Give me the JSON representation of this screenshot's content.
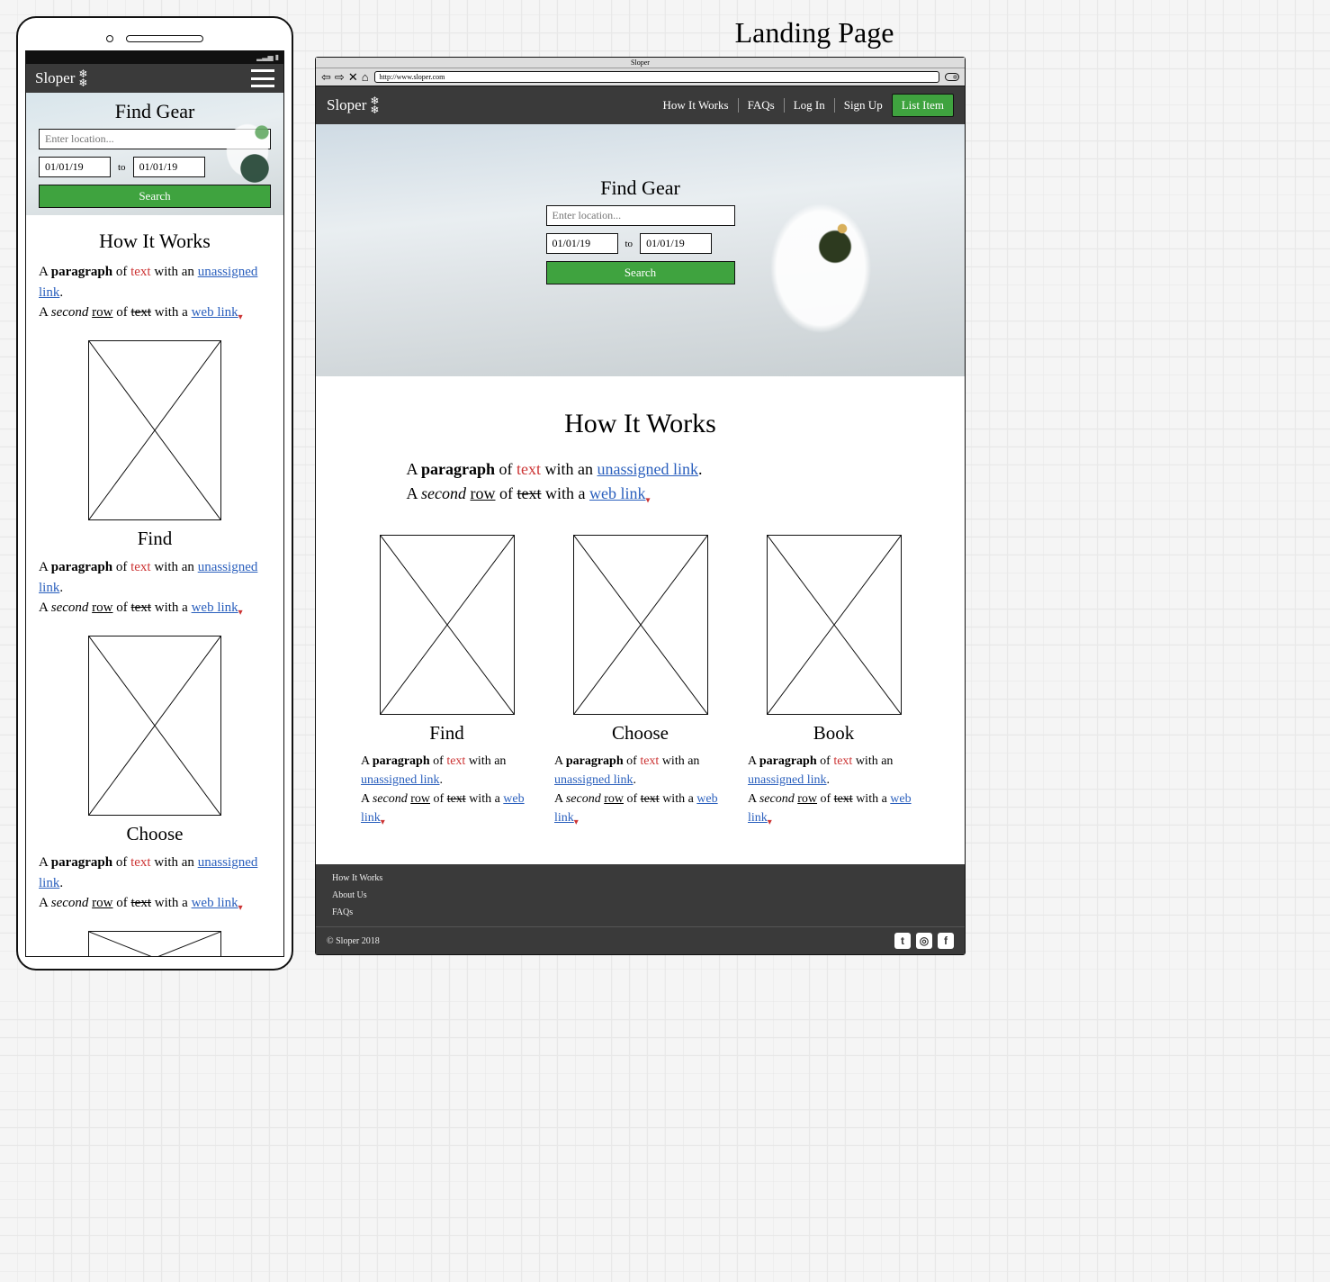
{
  "page_label": "Landing Page",
  "brand": "Sloper",
  "mobile": {
    "status_time": "",
    "hero_title": "Find Gear",
    "location_placeholder": "Enter location...",
    "date_from": "01/01/19",
    "date_to_label": "to",
    "date_to": "01/01/19",
    "search_label": "Search",
    "hiw_title": "How It Works",
    "sample_para": {
      "a": "A ",
      "paragraph": "paragraph",
      "of": " of ",
      "text": "text",
      "with_an": " with an ",
      "unassigned_link": "unassigned link",
      "period": ".",
      "second_prefix": "A ",
      "second": "second",
      "space": " ",
      "row": "row",
      "of2": " of ",
      "text2": "text",
      "with_a": " with a ",
      "web_link": "web link"
    },
    "cards": [
      {
        "title": "Find"
      },
      {
        "title": "Choose"
      }
    ]
  },
  "desktop": {
    "tab_title": "Sloper",
    "url": "http://www.sloper.com",
    "nav": {
      "how_it_works": "How It Works",
      "faqs": "FAQs",
      "log_in": "Log In",
      "sign_up": "Sign Up",
      "list_item": "List Item"
    },
    "hero_title": "Find Gear",
    "location_placeholder": "Enter location...",
    "date_from": "01/01/19",
    "date_to_label": "to",
    "date_to": "01/01/19",
    "search_label": "Search",
    "hiw_title": "How It Works",
    "cards": [
      {
        "title": "Find"
      },
      {
        "title": "Choose"
      },
      {
        "title": "Book"
      }
    ],
    "footer": {
      "links": [
        "How It Works",
        "About Us",
        "FAQs"
      ],
      "copyright": "© Sloper 2018"
    }
  }
}
